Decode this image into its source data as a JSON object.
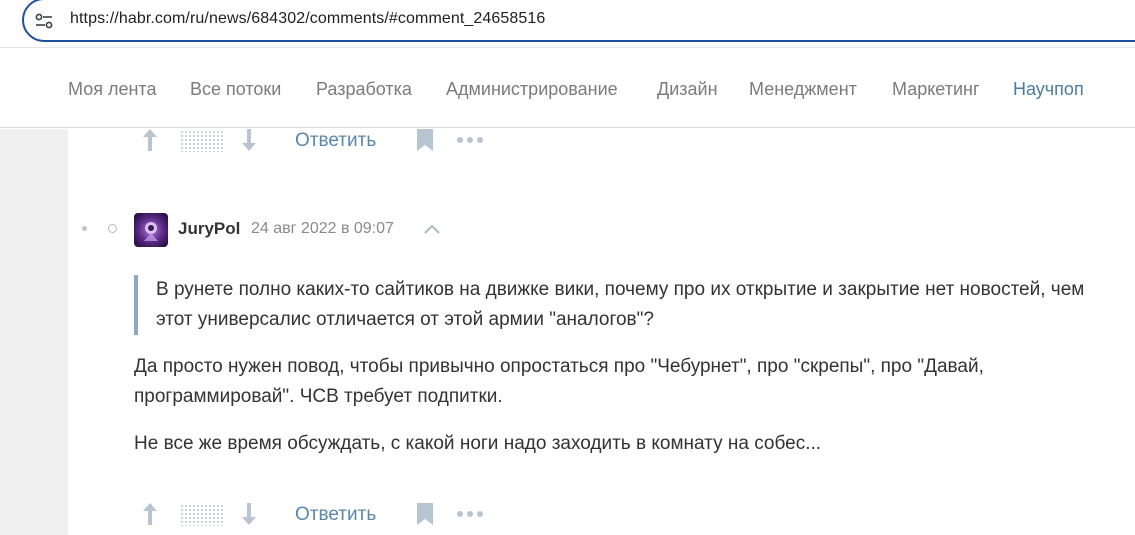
{
  "browser": {
    "url": "https://habr.com/ru/news/684302/comments/#comment_24658516"
  },
  "nav": {
    "items": [
      {
        "label": "Моя лента"
      },
      {
        "label": "Все потоки"
      },
      {
        "label": "Разработка"
      },
      {
        "label": "Администрирование"
      },
      {
        "label": "Дизайн"
      },
      {
        "label": "Менеджмент"
      },
      {
        "label": "Маркетинг"
      },
      {
        "label": "Научпоп"
      }
    ],
    "active_item": "Научпоп"
  },
  "prev_comment_actions": {
    "reply_label": "Ответить"
  },
  "comment": {
    "author": "JuryPol",
    "timestamp": "24 авг 2022 в 09:07",
    "quote": "В рунете полно каких-то сайтиков на движке вики, почему про их открытие и закрытие нет новостей, чем этот универсалис отличается от этой армии \"аналогов\"?",
    "paragraphs": [
      "Да просто нужен повод, чтобы привычно опростаться про \"Чебурнет\", про \"скрепы\", про \"Давай, программировай\". ЧСВ требует подпитки.",
      "Не все же время обсуждать, с какой ноги надо заходить в комнату на собес..."
    ],
    "reply_label": "Ответить"
  },
  "colors": {
    "accent": "#5b87ac",
    "active_nav": "#4a7ba0",
    "address_border": "#1f4f9e",
    "quote_border": "#8fa9bf"
  }
}
